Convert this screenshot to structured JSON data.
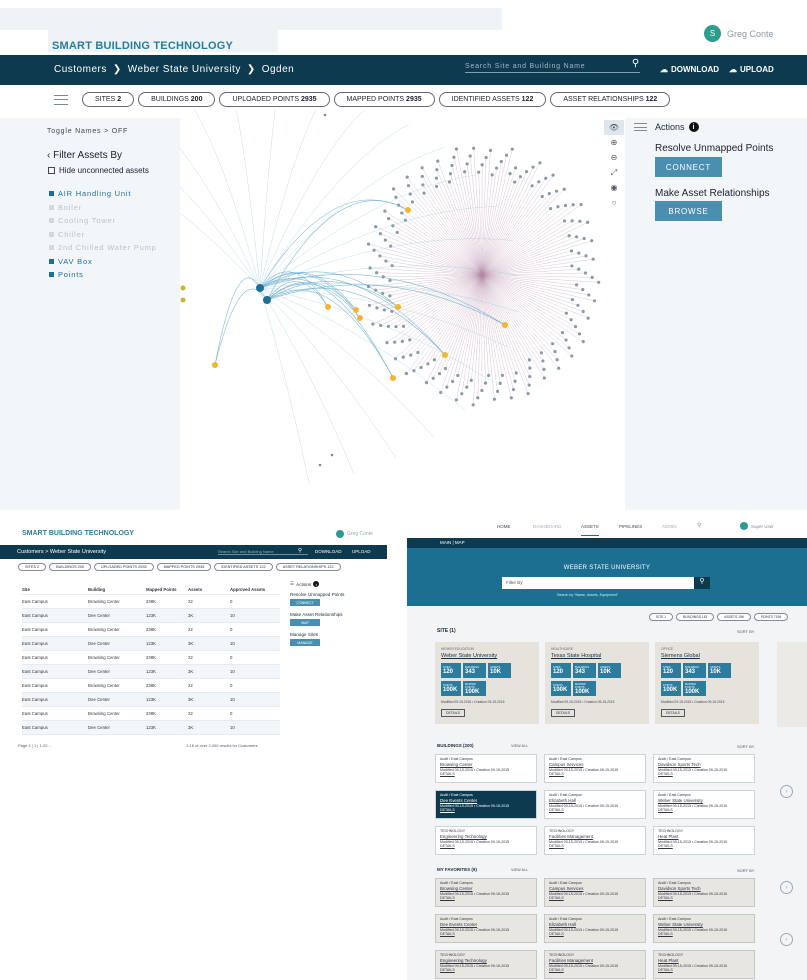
{
  "top": {
    "brand": "SMART BUILDING TECHNOLOGY",
    "user_initial": "S",
    "user_name": "Greg Conte",
    "crumbs": [
      "Customers",
      "Weber State University",
      "Ogden"
    ],
    "search_placeholder": "Search Site and Building Name",
    "download": "DOWNLOAD",
    "upload": "UPLOAD",
    "pills": [
      {
        "label": "SITES",
        "count": "2"
      },
      {
        "label": "BUILDINGS",
        "count": "200"
      },
      {
        "label": "UPLOADED POINTS",
        "count": "2935"
      },
      {
        "label": "MAPPED POINTS",
        "count": "2935"
      },
      {
        "label": "IDENTIFIED ASSETS",
        "count": "122"
      },
      {
        "label": "ASSET RELATIONSHIPS",
        "count": "122"
      }
    ],
    "toggle": "Toggle Names > OFF",
    "filter_title": "Filter Assets By",
    "hide_unconnected": "Hide unconnected assets",
    "filters": [
      {
        "label": "AIR Handling Unit",
        "on": true
      },
      {
        "label": "Boiler",
        "on": false
      },
      {
        "label": "Cooling Tower",
        "on": false
      },
      {
        "label": "Chiller",
        "on": false
      },
      {
        "label": "2nd Chilled Water Pump",
        "on": false
      },
      {
        "label": "VAV Box",
        "on": true
      },
      {
        "label": "Points",
        "on": true
      }
    ],
    "actions": "Actions",
    "resolve": "Resolve Unmapped Points",
    "connect": "CONNECT",
    "relationships": "Make Asset Relationships",
    "browse": "BROWSE"
  },
  "bottom_left": {
    "brand": "SMART BUILDING TECHNOLOGY",
    "user_name": "Greg Conte",
    "crumbs": [
      "Customers",
      "Weber State University"
    ],
    "search_placeholder": "Search Site and Building Name",
    "download": "DOWNLOAD",
    "upload": "UPLOAD",
    "pills": [
      "SITES 2",
      "BUILDINGS 200",
      "UPLOADED POINTS 2935",
      "MAPPED POINTS 2935",
      "IDENTIFIED ASSETS 122",
      "ASSET RELATIONSHIPS 122"
    ],
    "headers": [
      "Site",
      "Building",
      "Mapped Points",
      "Assets",
      "Approved Assets"
    ],
    "rows": [
      [
        "East Campus",
        "Browsing Center",
        "238K",
        "22",
        "0"
      ],
      [
        "East Campus",
        "Dee Center",
        "123K",
        "3K",
        "10"
      ],
      [
        "East Campus",
        "Browsing Center",
        "238K",
        "22",
        "0"
      ],
      [
        "East Campus",
        "Dee Center",
        "123K",
        "3K",
        "10"
      ],
      [
        "East Campus",
        "Browsing Center",
        "238K",
        "22",
        "0"
      ],
      [
        "East Campus",
        "Dee Center",
        "123K",
        "3K",
        "10"
      ],
      [
        "East Campus",
        "Browsing Center",
        "238K",
        "22",
        "0"
      ],
      [
        "East Campus",
        "Dee Center",
        "123K",
        "3K",
        "10"
      ],
      [
        "East Campus",
        "Browsing Center",
        "238K",
        "22",
        "0"
      ],
      [
        "East Campus",
        "Dee Center",
        "123K",
        "3K",
        "10"
      ]
    ],
    "pagination": "Page 1 | 1 | 1-22 ...",
    "results": "1-16 of over 2,000 results for Customers",
    "actions": "Actions",
    "resolve": "Resolve Unmapped Points",
    "connect": "CONNECT",
    "relationships": "Make Asset Relationships",
    "map": "MAP",
    "manage_sites": "Manage Sites",
    "manage": "MANAGE"
  },
  "bottom_right": {
    "nav": [
      "HOME",
      "DASHBOARD",
      "ASSETS",
      "PIPELINES",
      "ADMIN"
    ],
    "user": "Super User",
    "dark_crumb": "MAIN | MAP",
    "hero_title": "WEBER STATE UNIVERSITY",
    "filter_placeholder": "Filter By",
    "filter_hint": "Search by \"Name, Assets, Equipment\"",
    "pills": [
      "SITE 1",
      "BUILDINGS 143",
      "ASSETS 196",
      "POINTS 7196"
    ],
    "site_header": "SITE (1)",
    "sort": "SORT BY",
    "sites": [
      {
        "tag": "HIGHER EDUCATION",
        "name": "Weber State University",
        "stats": [
          "120",
          "343",
          "10K",
          "100K",
          "100K"
        ],
        "modified": "Modified 09-15-2015 • Creation 09-15-2015",
        "details": "DETAILS"
      },
      {
        "tag": "HEALTHCARE",
        "name": "Texas State Hospital",
        "stats": [
          "120",
          "343",
          "10K",
          "100K",
          "100K"
        ],
        "modified": "Modified 09-15-2015 • Creation 09-15-2015",
        "details": "DETAILS"
      },
      {
        "tag": "OFFICE",
        "name": "Siemens Global",
        "stats": [
          "120",
          "343",
          "10K",
          "100K",
          "100K"
        ],
        "modified": "Modified 09-15-2015 • Creation 09-15-2015",
        "details": "DETAILS"
      }
    ],
    "stat_labels": [
      "SITES",
      "BUILDINGS",
      "ASSETS",
      "POINTS",
      "MAPPED POINTS"
    ],
    "buildings_header": "BUILDINGS (200)",
    "view_all": "VIEW ALL",
    "buildings": [
      [
        "Audit / East Campus",
        "Browsing Center"
      ],
      [
        "Audit / East Campus",
        "Campus Services"
      ],
      [
        "Audit / East Campus",
        "Davidson Sports Tech"
      ],
      [
        "Audit / East Campus",
        "Dee Events Center"
      ],
      [
        "Audit / East Campus",
        "Elizabeth Hall"
      ],
      [
        "Audit / East Campus",
        "Weber State University"
      ],
      [
        "TECHNOLOGY",
        "Engineering Technology"
      ],
      [
        "TECHNOLOGY",
        "Facilities Management"
      ],
      [
        "TECHNOLOGY",
        "Heat Plant"
      ]
    ],
    "favorites_header": "MY FAVORITES (9)",
    "card_meta": "Modified 09-15-2015 • Creation 09-15-2015",
    "details": "DETAILS"
  }
}
